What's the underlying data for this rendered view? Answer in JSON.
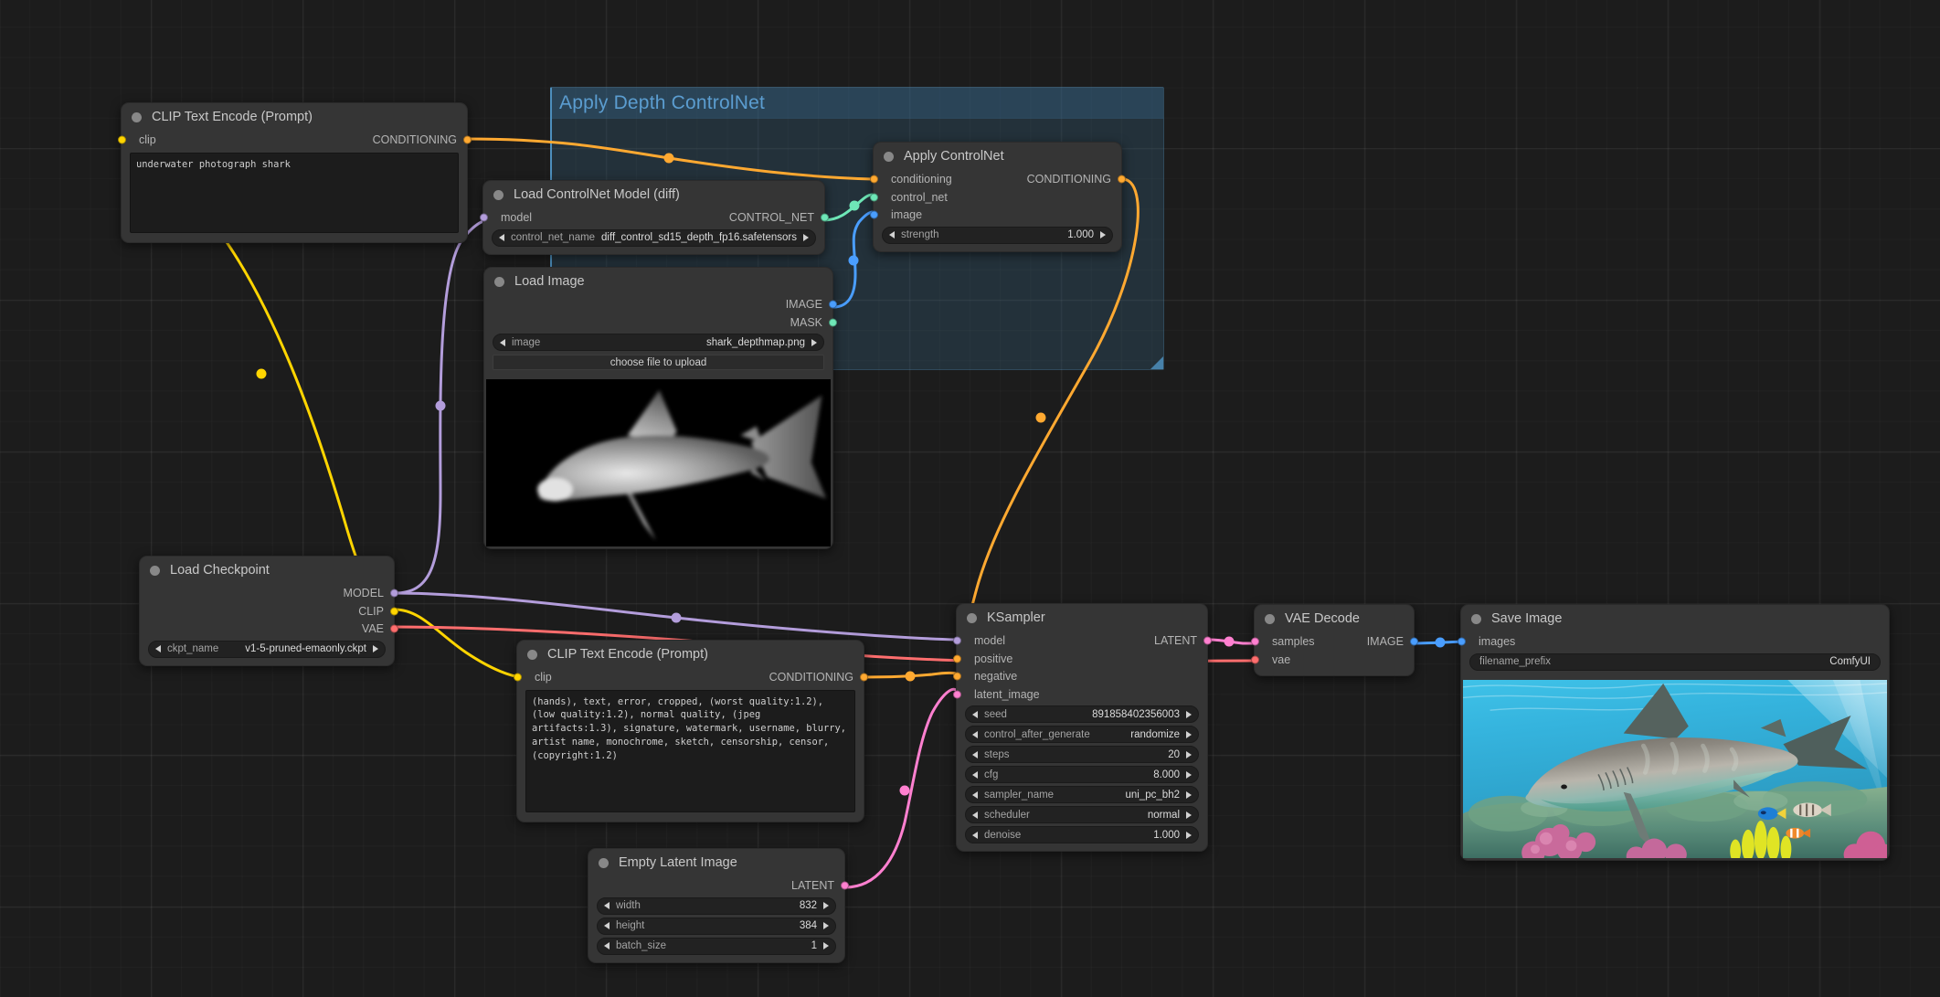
{
  "canvas": {
    "background_color": "#1c1c1c",
    "grid": "on"
  },
  "groups": [
    {
      "title": "Apply Depth ControlNet",
      "color": "#4d8fbd"
    }
  ],
  "nodes": {
    "positive_prompt": {
      "title": "CLIP Text Encode (Prompt)",
      "inputs": [
        {
          "name": "clip",
          "color": "#ffd500"
        }
      ],
      "outputs": [
        {
          "name": "CONDITIONING",
          "color": "#ffa931"
        }
      ],
      "text": "underwater photograph shark"
    },
    "negative_prompt": {
      "title": "CLIP Text Encode (Prompt)",
      "inputs": [
        {
          "name": "clip",
          "color": "#ffd500"
        }
      ],
      "outputs": [
        {
          "name": "CONDITIONING",
          "color": "#ffa931"
        }
      ],
      "text": "(hands), text, error, cropped, (worst quality:1.2), (low quality:1.2), normal quality, (jpeg artifacts:1.3), signature, watermark, username, blurry, artist name, monochrome, sketch, censorship, censor, (copyright:1.2)"
    },
    "load_controlnet": {
      "title": "Load ControlNet Model (diff)",
      "inputs": [
        {
          "name": "model",
          "color": "#b39ddb"
        }
      ],
      "outputs": [
        {
          "name": "CONTROL_NET",
          "color": "#6ee7b7"
        }
      ],
      "widgets": [
        {
          "name": "control_net_name",
          "value": "diff_control_sd15_depth_fp16.safetensors"
        }
      ]
    },
    "apply_controlnet": {
      "title": "Apply ControlNet",
      "inputs": [
        {
          "name": "conditioning",
          "color": "#ffa931"
        },
        {
          "name": "control_net",
          "color": "#6ee7b7"
        },
        {
          "name": "image",
          "color": "#4a9eff"
        }
      ],
      "outputs": [
        {
          "name": "CONDITIONING",
          "color": "#ffa931"
        }
      ],
      "widgets": [
        {
          "name": "strength",
          "value": "1.000"
        }
      ]
    },
    "load_image": {
      "title": "Load Image",
      "outputs": [
        {
          "name": "IMAGE",
          "color": "#4a9eff"
        },
        {
          "name": "MASK",
          "color": "#6ee7b7"
        }
      ],
      "widgets": [
        {
          "name": "image",
          "value": "shark_depthmap.png"
        }
      ],
      "upload_button": "choose file to upload",
      "preview_alt": "grayscale depth map of a shark"
    },
    "load_checkpoint": {
      "title": "Load Checkpoint",
      "outputs": [
        {
          "name": "MODEL",
          "color": "#b39ddb"
        },
        {
          "name": "CLIP",
          "color": "#ffd500"
        },
        {
          "name": "VAE",
          "color": "#ff6e6e"
        }
      ],
      "widgets": [
        {
          "name": "ckpt_name",
          "value": "v1-5-pruned-emaonly.ckpt"
        }
      ]
    },
    "empty_latent": {
      "title": "Empty Latent Image",
      "outputs": [
        {
          "name": "LATENT",
          "color": "#ff80d0"
        }
      ],
      "widgets": [
        {
          "name": "width",
          "value": "832"
        },
        {
          "name": "height",
          "value": "384"
        },
        {
          "name": "batch_size",
          "value": "1"
        }
      ]
    },
    "ksampler": {
      "title": "KSampler",
      "inputs": [
        {
          "name": "model",
          "color": "#b39ddb"
        },
        {
          "name": "positive",
          "color": "#ffa931"
        },
        {
          "name": "negative",
          "color": "#ffa931"
        },
        {
          "name": "latent_image",
          "color": "#ff80d0"
        }
      ],
      "outputs": [
        {
          "name": "LATENT",
          "color": "#ff80d0"
        }
      ],
      "widgets": [
        {
          "name": "seed",
          "value": "891858402356003"
        },
        {
          "name": "control_after_generate",
          "value": "randomize"
        },
        {
          "name": "steps",
          "value": "20"
        },
        {
          "name": "cfg",
          "value": "8.000"
        },
        {
          "name": "sampler_name",
          "value": "uni_pc_bh2"
        },
        {
          "name": "scheduler",
          "value": "normal"
        },
        {
          "name": "denoise",
          "value": "1.000"
        }
      ]
    },
    "vae_decode": {
      "title": "VAE Decode",
      "inputs": [
        {
          "name": "samples",
          "color": "#ff80d0"
        },
        {
          "name": "vae",
          "color": "#ff6e6e"
        }
      ],
      "outputs": [
        {
          "name": "IMAGE",
          "color": "#4a9eff"
        }
      ]
    },
    "save_image": {
      "title": "Save Image",
      "inputs": [
        {
          "name": "images",
          "color": "#4a9eff"
        }
      ],
      "widgets": [
        {
          "name": "filename_prefix",
          "value": "ComfyUI"
        }
      ],
      "preview_alt": "underwater photograph of a shark over a coral reef"
    }
  },
  "link_colors": {
    "MODEL": "#b39ddb",
    "CLIP": "#ffd500",
    "VAE": "#ff6e6e",
    "CONDITIONING": "#ffa931",
    "CONTROL_NET": "#6ee7b7",
    "IMAGE": "#4a9eff",
    "LATENT": "#ff80d0"
  }
}
